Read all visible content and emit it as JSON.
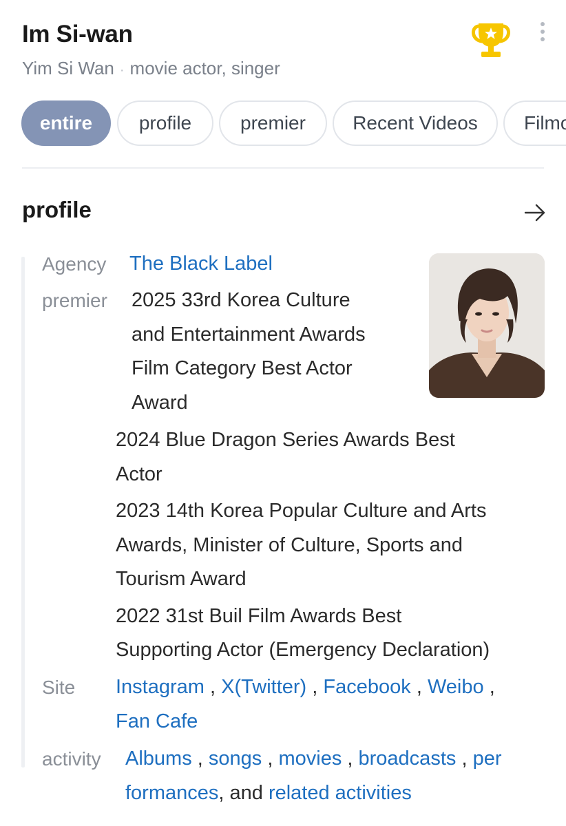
{
  "header": {
    "title": "Im Si-wan",
    "subtitle_name": "Yim Si Wan",
    "subtitle_separator": "·",
    "subtitle_role": "movie actor, singer",
    "trophy_icon": "trophy-icon",
    "menu_icon": "more-vertical-icon"
  },
  "tabs": [
    {
      "label": "entire",
      "active": true
    },
    {
      "label": "profile",
      "active": false
    },
    {
      "label": "premier",
      "active": false
    },
    {
      "label": "Recent Videos",
      "active": false
    },
    {
      "label": "Filmography",
      "active": false
    }
  ],
  "profile": {
    "section_title": "profile",
    "arrow_icon": "arrow-right-icon",
    "agency": {
      "label": "Agency",
      "value": "The Black Label"
    },
    "premier": {
      "label": "premier",
      "first_lines": [
        "2025 33rd Korea Culture",
        "and Entertainment Awards",
        "Film Category Best Actor",
        "Award"
      ],
      "more_lines": [
        "2024 Blue Dragon Series Awards Best",
        "Actor",
        "2023 14th Korea Popular Culture and Arts",
        "Awards, Minister of Culture, Sports and",
        "Tourism Award",
        "2022 31st Buil Film Awards Best",
        "Supporting Actor (Emergency Declaration)"
      ]
    },
    "site": {
      "label": "Site",
      "links": [
        "Instagram",
        "X(Twitter)",
        "Facebook",
        "Weibo",
        "Fan Cafe"
      ],
      "separator": ","
    },
    "activity": {
      "label": "activity",
      "links": [
        "Albums",
        "songs",
        "movies",
        "broadcasts",
        "per",
        "formances",
        "related activities"
      ],
      "separator": ",",
      "and_text": ", and"
    },
    "photo_icon": "profile-photo"
  },
  "colors": {
    "accent": "#8494b5",
    "link": "#1e6fc0",
    "trophy": "#f5c400"
  }
}
